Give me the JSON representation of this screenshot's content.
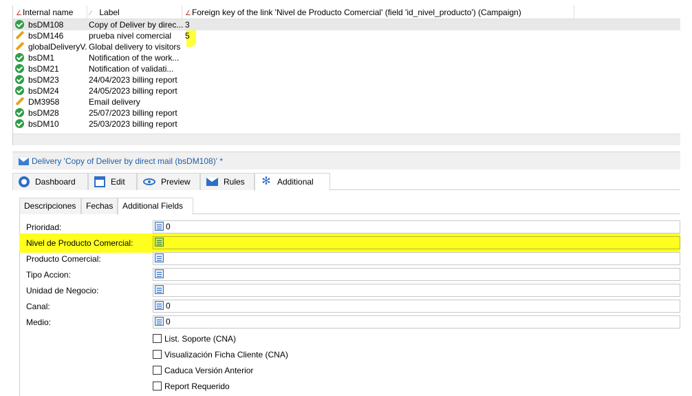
{
  "grid": {
    "columns": [
      {
        "label": "Internal name"
      },
      {
        "label": "Label"
      },
      {
        "label": "Foreign key of the link 'Nivel de Producto Comercial' (field 'id_nivel_producto') (Campaign)"
      }
    ],
    "rows": [
      {
        "status": "ok",
        "name": "bsDM108",
        "label": "Copy of Deliver by direc...",
        "fk": "3",
        "selected": true
      },
      {
        "status": "edit",
        "name": "bsDM146",
        "label": "prueba nivel  comercial",
        "fk": "5"
      },
      {
        "status": "edit",
        "name": "globalDeliveryV.",
        "label": "Global delivery to visitors",
        "fk": ""
      },
      {
        "status": "ok",
        "name": "bsDM1",
        "label": "Notification of the work...",
        "fk": ""
      },
      {
        "status": "ok",
        "name": "bsDM21",
        "label": "Notification of validati...",
        "fk": ""
      },
      {
        "status": "ok",
        "name": "bsDM23",
        "label": "24/04/2023 billing report",
        "fk": ""
      },
      {
        "status": "ok",
        "name": "bsDM24",
        "label": "24/05/2023 billing report",
        "fk": ""
      },
      {
        "status": "edit",
        "name": "DM3958",
        "label": "Email delivery",
        "fk": ""
      },
      {
        "status": "ok",
        "name": "bsDM28",
        "label": "25/07/2023 billing report",
        "fk": ""
      },
      {
        "status": "ok",
        "name": "bsDM10",
        "label": "25/03/2023 billing report",
        "fk": ""
      }
    ]
  },
  "delivery": {
    "title": "Delivery 'Copy of Deliver by direct mail (bsDM108)' *"
  },
  "tabs": [
    {
      "label": "Dashboard",
      "icon": "dashboard-icon"
    },
    {
      "label": "Edit",
      "icon": "edit-icon"
    },
    {
      "label": "Preview",
      "icon": "eye-icon"
    },
    {
      "label": "Rules",
      "icon": "mail-icon"
    },
    {
      "label": "Additional",
      "icon": "snowflake-icon",
      "active": true
    }
  ],
  "subtabs": [
    {
      "label": "Descripciones"
    },
    {
      "label": "Fechas"
    },
    {
      "label": "Additional Fields",
      "active": true
    }
  ],
  "fields": [
    {
      "label": "Prioridad:",
      "value": "0"
    },
    {
      "label": "Nivel de Producto Comercial:",
      "value": "",
      "highlighted": true
    },
    {
      "label": "Producto Comercial:",
      "value": ""
    },
    {
      "label": "Tipo Accion:",
      "value": ""
    },
    {
      "label": "Unidad de Negocio:",
      "value": ""
    },
    {
      "label": "Canal:",
      "value": "0"
    },
    {
      "label": "Medio:",
      "value": "0"
    }
  ],
  "checkboxes": [
    {
      "label": "List. Soporte (CNA)",
      "checked": false
    },
    {
      "label": "Visualización Ficha Cliente (CNA)",
      "checked": false
    },
    {
      "label": "Caduca Versión Anterior",
      "checked": false
    },
    {
      "label": "Report Requerido",
      "checked": false
    }
  ],
  "colors": {
    "highlight": "#ffff1f",
    "ok_status": "#2e9e47",
    "edit_status": "#e8a317",
    "title_text": "#1f5fa8"
  }
}
